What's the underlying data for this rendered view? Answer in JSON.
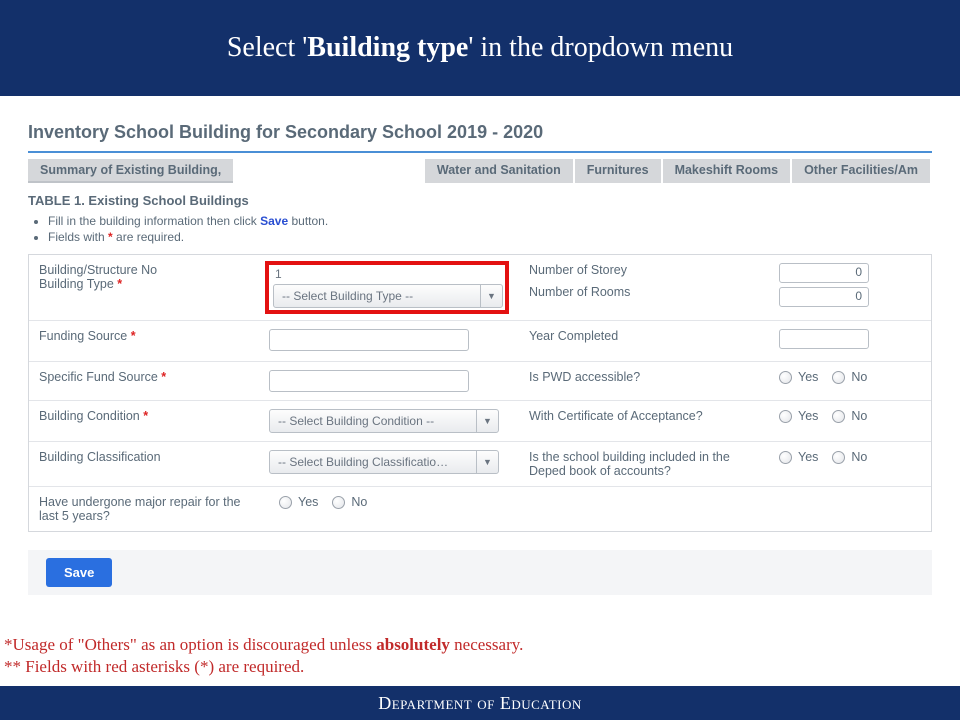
{
  "banner": {
    "pre": "Select '",
    "bold": "Building type",
    "post": "' in the dropdown menu"
  },
  "page_title": "Inventory School Building for Secondary School 2019 - 2020",
  "tabs": {
    "active": "Summary of Existing Building,",
    "t1": "Water and Sanitation",
    "t2": "Furnitures",
    "t3": "Makeshift Rooms",
    "t4": "Other Facilities/Am"
  },
  "table_title": "TABLE 1. Existing School Buildings",
  "instructions": {
    "li1a": "Fill in the building information then click ",
    "li1b": "Save",
    "li1c": " button.",
    "li2a": "Fields with ",
    "li2c": " are required."
  },
  "labels": {
    "structure_no": "Building/Structure No",
    "building_type": "Building Type ",
    "number_storey": "Number of Storey",
    "number_rooms": "Number of Rooms",
    "funding_source": "Funding Source ",
    "year_completed": "Year Completed",
    "specific_fund": "Specific Fund Source ",
    "pwd": "Is PWD accessible?",
    "condition": "Building Condition ",
    "cert": "With Certificate of Acceptance?",
    "classification": "Building Classification",
    "deped_book": "Is the school building included in the Deped book of accounts?",
    "repair": "Have undergone major repair for the last 5 years?"
  },
  "asterisk": "*",
  "values": {
    "structure_no": "1",
    "building_type_placeholder": "-- Select Building Type --",
    "storey": "0",
    "rooms": "0",
    "condition_placeholder": "-- Select Building Condition --",
    "classification_placeholder": "-- Select Building Classificatio…"
  },
  "options": {
    "yes": "Yes",
    "no": "No"
  },
  "save": "Save",
  "footnotes": {
    "l1a": "*Usage of \"Others\" as an option is discouraged unless ",
    "l1b": "absolutely",
    "l1c": " necessary.",
    "l2": "** Fields with red asterisks (*) are required."
  },
  "footer": "Department of Education"
}
